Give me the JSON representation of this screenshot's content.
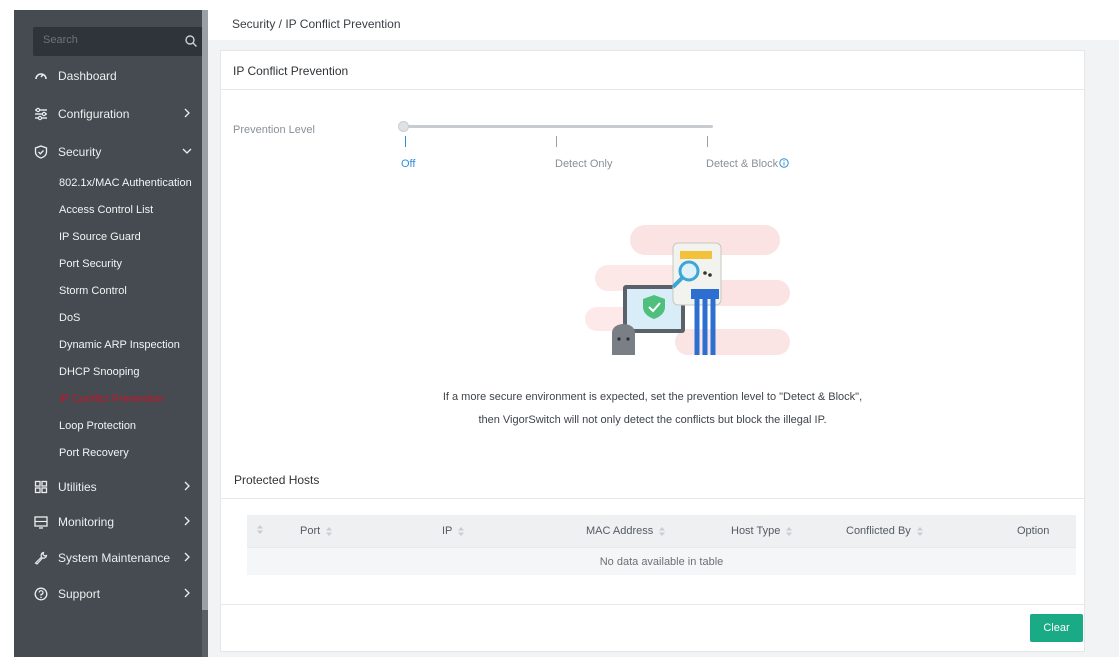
{
  "search": {
    "placeholder": "Search"
  },
  "sidebar": {
    "items": [
      {
        "label": "Dashboard",
        "icon": "dashboard-icon"
      },
      {
        "label": "Configuration",
        "icon": "configuration-icon"
      },
      {
        "label": "Security",
        "icon": "shield-icon"
      },
      {
        "label": "Utilities",
        "icon": "utilities-icon"
      },
      {
        "label": "Monitoring",
        "icon": "monitoring-icon"
      },
      {
        "label": "System Maintenance",
        "icon": "wrench-icon"
      },
      {
        "label": "Support",
        "icon": "help-icon"
      }
    ],
    "security_sub": [
      "802.1x/MAC Authentication",
      "Access Control List",
      "IP Source Guard",
      "Port Security",
      "Storm Control",
      "DoS",
      "Dynamic ARP Inspection",
      "DHCP Snooping",
      "IP Conflict Prevention",
      "Loop Protection",
      "Port Recovery"
    ],
    "active_sub": "IP Conflict Prevention"
  },
  "breadcrumb": "Security / IP Conflict Prevention",
  "card": {
    "title": "IP Conflict Prevention"
  },
  "prevention": {
    "label": "Prevention Level",
    "levels": [
      "Off",
      "Detect Only",
      "Detect & Block"
    ],
    "selected": "Off"
  },
  "hint": {
    "line1": "If a more secure environment is expected, set the prevention level to \"Detect & Block\",",
    "line2": "then VigorSwitch will not only detect the conflicts but block the illegal IP."
  },
  "protected_hosts": {
    "title": "Protected Hosts",
    "columns": [
      "Port",
      "IP",
      "MAC Address",
      "Host Type",
      "Conflicted By",
      "Option"
    ],
    "empty_text": "No data available in table"
  },
  "actions": {
    "clear_label": "Clear"
  },
  "colors": {
    "sidebar_bg": "#454b51",
    "active_red": "#c0182c",
    "accent_blue": "#2f8fd6",
    "clear_green": "#1aaa86"
  }
}
